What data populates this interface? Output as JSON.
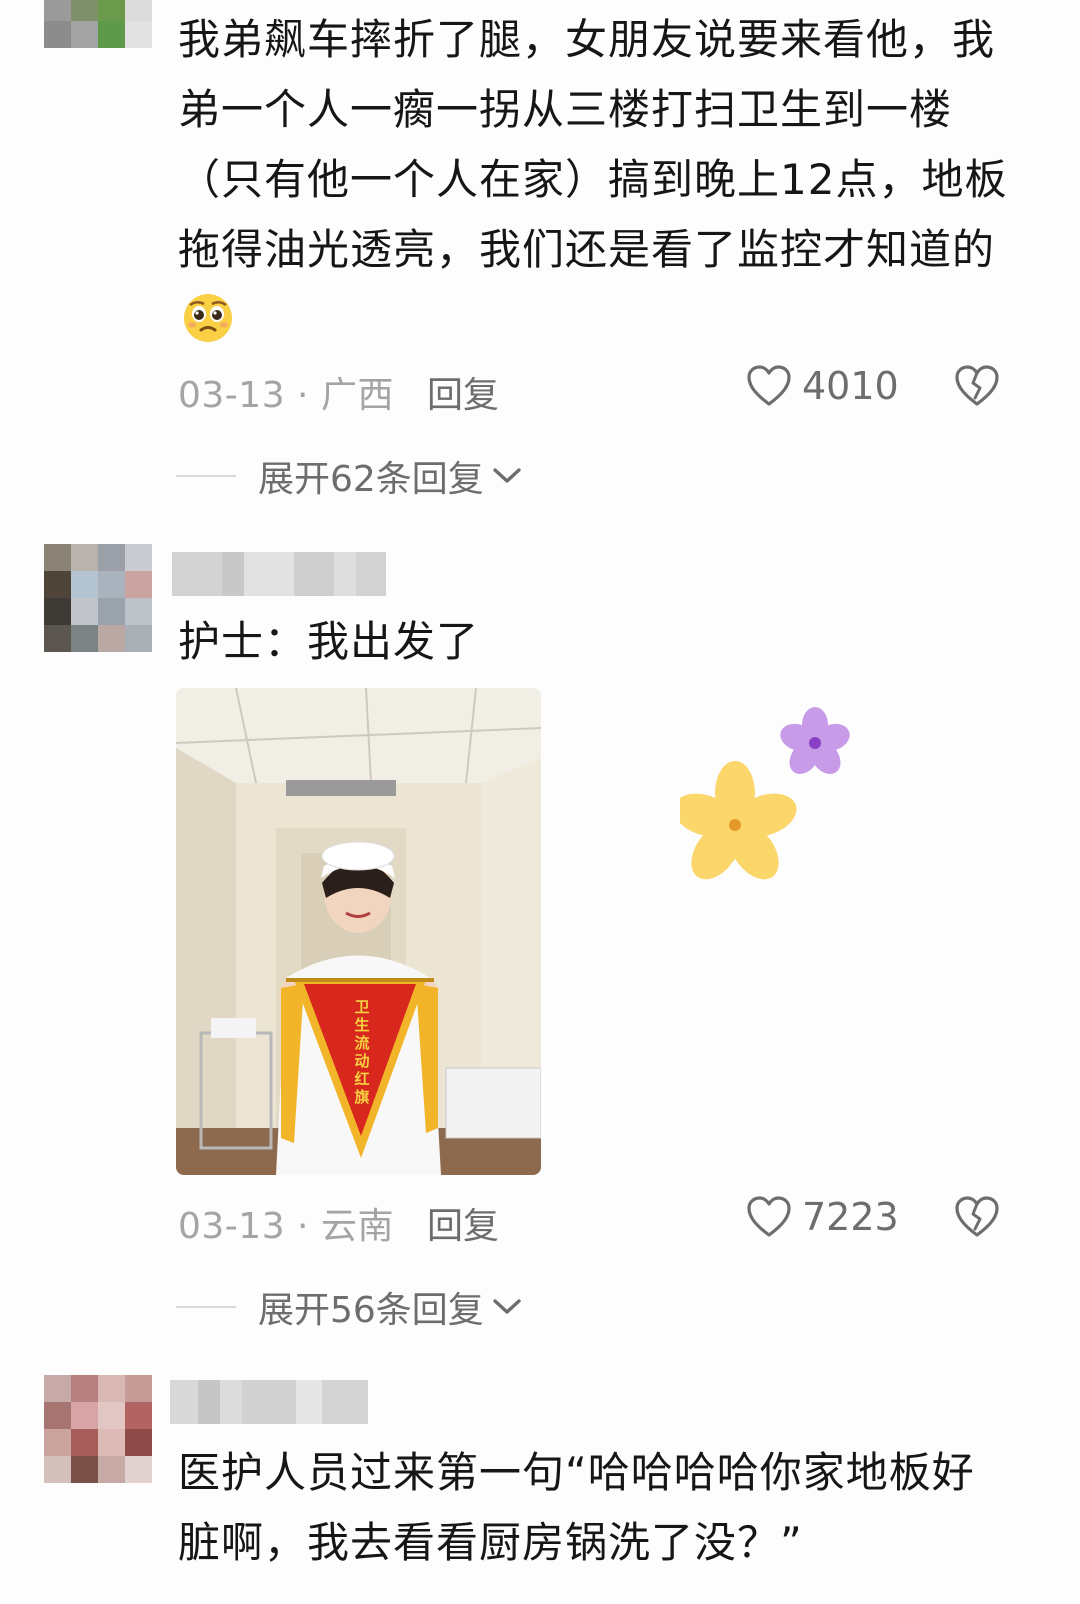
{
  "comments": [
    {
      "text": "我弟飙车摔折了腿，女朋友说要来看他，我弟一个人一瘸一拐从三楼打扫卫生到一楼（只有他一个人在家）搞到晚上12点，地板拖得油光透亮，我们还是看了监控才知道的",
      "emoji": "pleading-face-emoji",
      "date_location": "03-13 · 广西",
      "reply_label": "回复",
      "likes": "4010",
      "expand_label": "展开62条回复"
    },
    {
      "text": "护士：我出发了",
      "image_caption": "卫生流动红旗",
      "date_location": "03-13 · 云南",
      "reply_label": "回复",
      "likes": "7223",
      "expand_label": "展开56条回复"
    },
    {
      "text": "医护人员过来第一句“哈哈哈哈你家地板好脏啊，我去看看厨房锅洗了没？”"
    }
  ],
  "colors": {
    "text": "#161616",
    "meta": "#a4a4a4",
    "action": "#6d6d6d",
    "pennant": "#d8281e",
    "fringe": "#f2b52a"
  },
  "icons": {
    "like": "heart-outline-icon",
    "dislike": "broken-heart-icon",
    "expand": "chevron-down-icon",
    "decor": "flower-sticker"
  }
}
